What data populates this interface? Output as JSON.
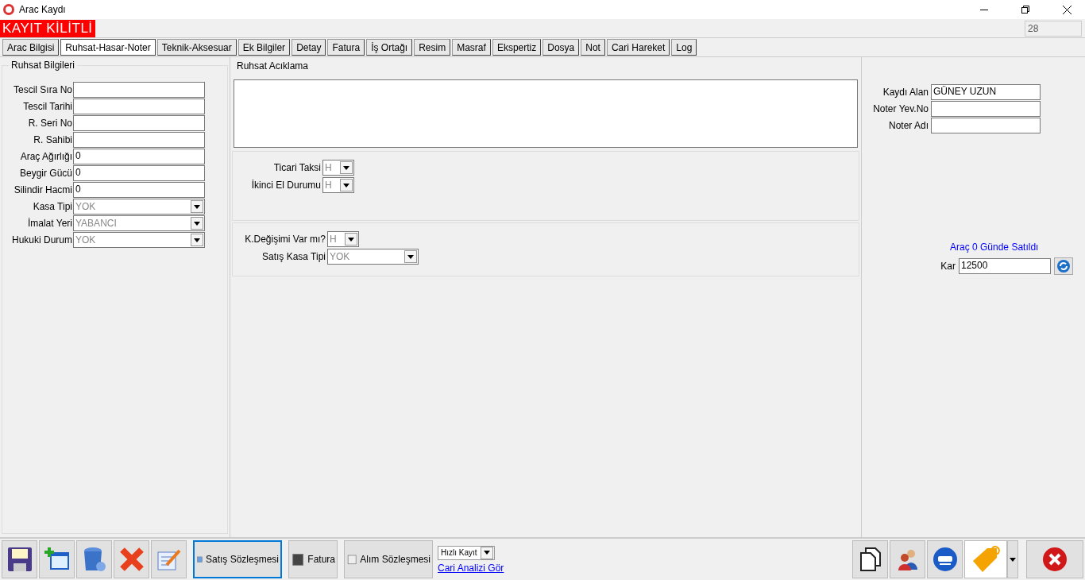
{
  "window": {
    "title": "Arac Kaydı"
  },
  "lock_banner": "KAYIT KİLİTLİ",
  "record_no": "28",
  "tabs": [
    {
      "label": "Arac Bilgisi",
      "selected": false
    },
    {
      "label": "Ruhsat-Hasar-Noter",
      "selected": true
    },
    {
      "label": "Teknik-Aksesuar",
      "selected": false
    },
    {
      "label": "Ek Bilgiler",
      "selected": false
    },
    {
      "label": "Detay",
      "selected": false
    },
    {
      "label": "Fatura",
      "selected": false
    },
    {
      "label": "İş Ortağı",
      "selected": false
    },
    {
      "label": "Resim",
      "selected": false
    },
    {
      "label": "Masraf",
      "selected": false
    },
    {
      "label": "Ekspertiz",
      "selected": false
    },
    {
      "label": "Dosya",
      "selected": false
    },
    {
      "label": "Not",
      "selected": false
    },
    {
      "label": "Cari Hareket",
      "selected": false
    },
    {
      "label": "Log",
      "selected": false
    }
  ],
  "left_panel": {
    "title": "Ruhsat Bilgileri",
    "fields": [
      {
        "label": "Tescil Sıra No",
        "kind": "text"
      },
      {
        "label": "Tescil Tarihi",
        "kind": "text"
      },
      {
        "label": "R. Seri No",
        "kind": "text"
      },
      {
        "label": "R. Sahibi",
        "kind": "text"
      },
      {
        "label": "Araç Ağırlığı",
        "kind": "text",
        "value": "0"
      },
      {
        "label": "Beygir Gücü",
        "kind": "text",
        "value": "0"
      },
      {
        "label": "Silindir Hacmi",
        "kind": "text",
        "value": "0"
      },
      {
        "label": "Kasa Tipi",
        "kind": "combo",
        "value": "YOK",
        "disabled": true
      },
      {
        "label": "İmalat Yeri",
        "kind": "combo",
        "value": "YABANCI",
        "disabled": true
      },
      {
        "label": "Hukuki Durum",
        "kind": "combo",
        "value": "YOK",
        "disabled": true
      }
    ]
  },
  "middle_panel": {
    "title": "Ruhsat Acıklama",
    "group_1": [
      {
        "label": "Ticari Taksi",
        "value": "H",
        "disabled": true
      },
      {
        "label": "İkinci El Durumu",
        "value": "H",
        "disabled": true
      }
    ],
    "group_2": [
      {
        "label": "K.Değişimi Var mı?",
        "value": "H",
        "disabled": true
      },
      {
        "label": "Satış Kasa Tipi",
        "value": "YOK",
        "disabled": true
      }
    ]
  },
  "right_panel": {
    "fields": [
      {
        "label": "Kaydı Alan",
        "value": "GÜNEY UZUN"
      },
      {
        "label": "Noter Yev.No"
      },
      {
        "label": "Noter Adı"
      }
    ],
    "sold_note": "Araç 0 Günde Satıldı",
    "profit": {
      "label": "Kar",
      "value": "12500"
    }
  },
  "toolbar": {
    "text_buttons": [
      {
        "label": "Satış Sözleşmesi",
        "focused": true
      },
      {
        "label": "Fatura",
        "focused": false
      },
      {
        "label": "Alım Sözleşmesi",
        "focused": false
      }
    ],
    "quick_select": "Hızlı Kayıt",
    "link": "Cari Analizi Gör"
  }
}
